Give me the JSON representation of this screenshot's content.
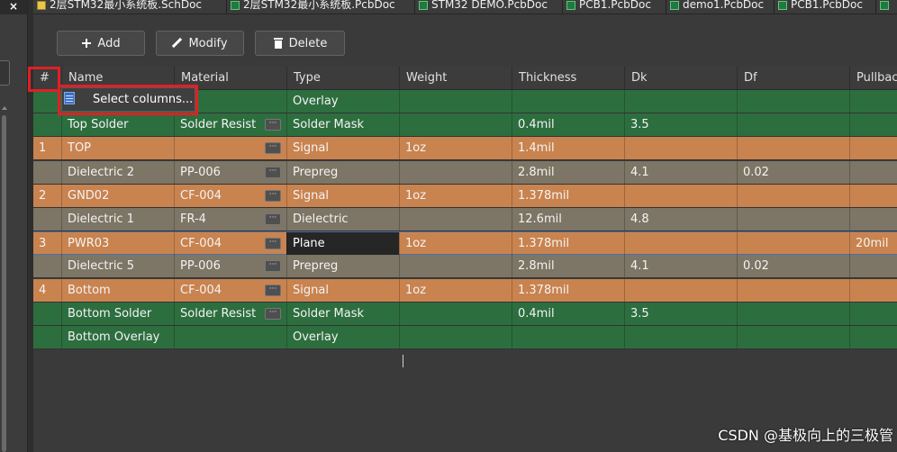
{
  "window": {
    "close_glyph": "×"
  },
  "tabs": [
    {
      "label": "2层STM32最小系统板.SchDoc",
      "icon": "schematic-doc-icon"
    },
    {
      "label": "2层STM32最小系统板.PcbDoc",
      "icon": "pcb-doc-icon"
    },
    {
      "label": "STM32 DEMO.PcbDoc",
      "icon": "pcb-doc-icon"
    },
    {
      "label": "PCB1.PcbDoc",
      "icon": "pcb-doc-icon"
    },
    {
      "label": "demo1.PcbDoc",
      "icon": "pcb-doc-icon"
    },
    {
      "label": "PCB1.PcbDoc",
      "icon": "pcb-doc-icon"
    }
  ],
  "toolbar": {
    "add_label": "Add",
    "modify_label": "Modify",
    "delete_label": "Delete",
    "add_icon": "plus-icon",
    "modify_icon": "pencil-icon",
    "delete_icon": "trash-icon"
  },
  "table": {
    "columns": [
      "#",
      "Name",
      "Material",
      "Type",
      "Weight",
      "Thickness",
      "Dk",
      "Df",
      "Pullbac"
    ],
    "ellipsis_glyph": "···",
    "rows": [
      {
        "num": "",
        "name": "",
        "material": "",
        "type": "Overlay",
        "weight": "",
        "thickness": "",
        "dk": "",
        "df": "",
        "pullback": "",
        "style": "green",
        "ellipsis": false
      },
      {
        "num": "",
        "name": "Top Solder",
        "material": "Solder Resist",
        "type": "Solder Mask",
        "weight": "",
        "thickness": "0.4mil",
        "dk": "3.5",
        "df": "",
        "pullback": "",
        "style": "green",
        "ellipsis": true
      },
      {
        "num": "1",
        "name": "TOP",
        "material": "",
        "type": "Signal",
        "weight": "1oz",
        "thickness": "1.4mil",
        "dk": "",
        "df": "",
        "pullback": "",
        "style": "orange",
        "ellipsis": true
      },
      {
        "num": "",
        "name": "Dielectric 2",
        "material": "PP-006",
        "type": "Prepreg",
        "weight": "",
        "thickness": "2.8mil",
        "dk": "4.1",
        "df": "0.02",
        "pullback": "",
        "style": "gray",
        "ellipsis": true
      },
      {
        "num": "2",
        "name": "GND02",
        "material": "CF-004",
        "type": "Signal",
        "weight": "1oz",
        "thickness": "1.378mil",
        "dk": "",
        "df": "",
        "pullback": "",
        "style": "orange",
        "ellipsis": true
      },
      {
        "num": "",
        "name": "Dielectric 1",
        "material": "FR-4",
        "type": "Dielectric",
        "weight": "",
        "thickness": "12.6mil",
        "dk": "4.8",
        "df": "",
        "pullback": "",
        "style": "gray",
        "ellipsis": true
      },
      {
        "num": "3",
        "name": "PWR03",
        "material": "CF-004",
        "type": "Plane",
        "weight": "1oz",
        "thickness": "1.378mil",
        "dk": "",
        "df": "",
        "pullback": "20mil",
        "style": "orange",
        "ellipsis": true,
        "selected": true
      },
      {
        "num": "",
        "name": "Dielectric 5",
        "material": "PP-006",
        "type": "Prepreg",
        "weight": "",
        "thickness": "2.8mil",
        "dk": "4.1",
        "df": "0.02",
        "pullback": "",
        "style": "gray",
        "ellipsis": true
      },
      {
        "num": "4",
        "name": "Bottom",
        "material": "CF-004",
        "type": "Signal",
        "weight": "1oz",
        "thickness": "1.378mil",
        "dk": "",
        "df": "",
        "pullback": "",
        "style": "orange",
        "ellipsis": true
      },
      {
        "num": "",
        "name": "Bottom Solder",
        "material": "Solder Resist",
        "type": "Solder Mask",
        "weight": "",
        "thickness": "0.4mil",
        "dk": "3.5",
        "df": "",
        "pullback": "",
        "style": "green",
        "ellipsis": true
      },
      {
        "num": "",
        "name": "Bottom Overlay",
        "material": "",
        "type": "Overlay",
        "weight": "",
        "thickness": "",
        "dk": "",
        "df": "",
        "pullback": "",
        "style": "green",
        "ellipsis": false
      }
    ]
  },
  "popup": {
    "label": "Select columns...",
    "icon": "columns-list-icon"
  },
  "colors": {
    "overlay_green": "#2d6e3f",
    "signal_orange": "#c9834f",
    "dielectric_gray": "#7d7565",
    "highlight_red": "#e01f26"
  },
  "watermark": "CSDN @基极向上的三极管"
}
